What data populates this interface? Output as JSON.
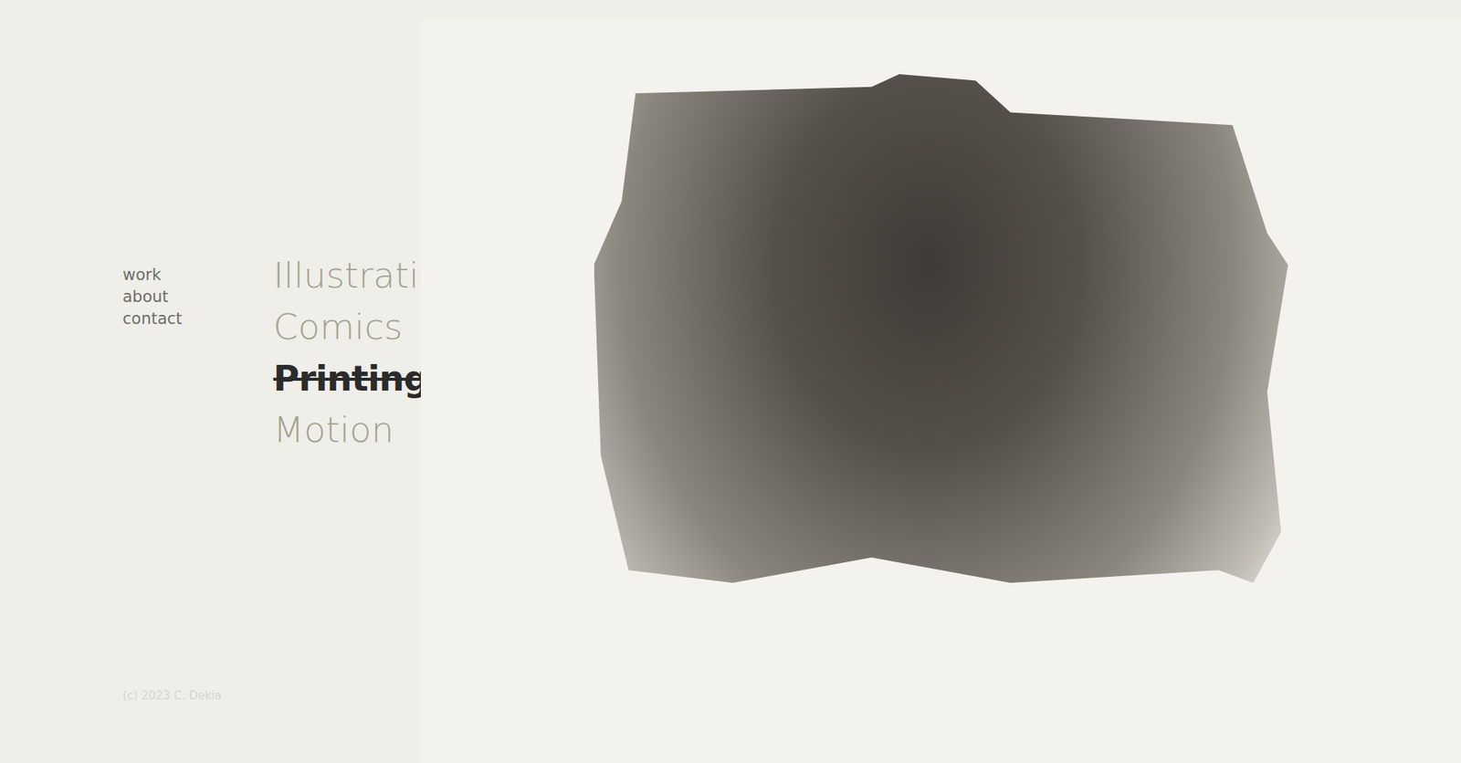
{
  "nav": [
    {
      "label": "work"
    },
    {
      "label": "about"
    },
    {
      "label": "contact"
    }
  ],
  "categories": [
    {
      "label": "Illustrations",
      "selected": false
    },
    {
      "label": "Comics",
      "selected": false
    },
    {
      "label": "Printings",
      "selected": true
    },
    {
      "label": "Motion",
      "selected": false
    }
  ],
  "footer": {
    "copyright": "(c) 2023 C. Dekia"
  }
}
